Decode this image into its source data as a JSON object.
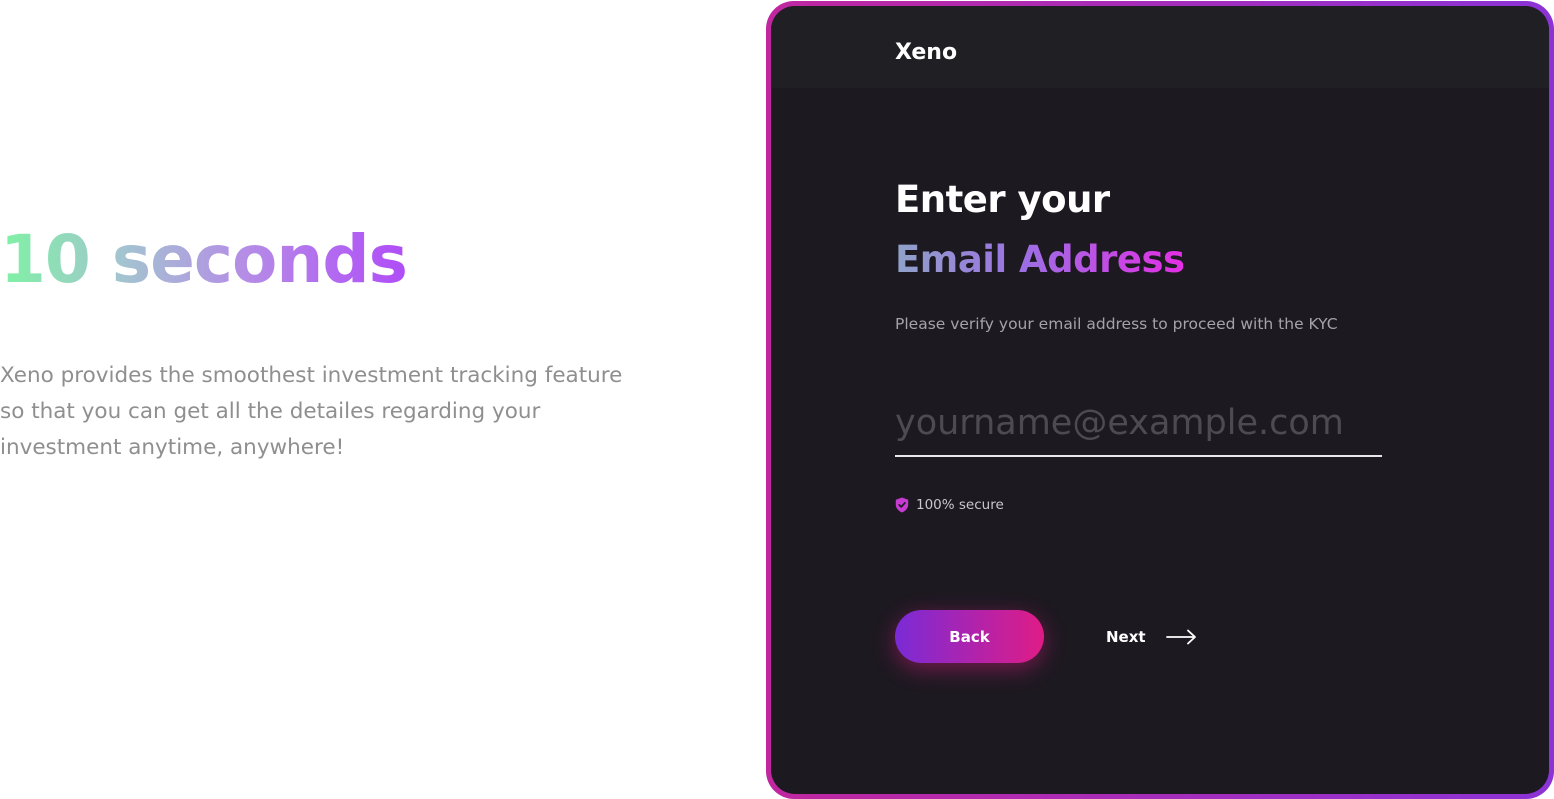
{
  "hero": {
    "heading": "10 seconds",
    "description": "Xeno provides the smoothest investment tracking feature so that you can get all the detailes regarding your investment anytime, anywhere!"
  },
  "app": {
    "brand": "Xeno",
    "title_line1": "Enter your",
    "title_line2": "Email Address",
    "subtitle": "Please verify your email address to proceed with the KYC",
    "email": {
      "placeholder": "yourname@example.com",
      "value": ""
    },
    "secure_label": "100% secure",
    "back_label": "Back",
    "next_label": "Next",
    "icons": {
      "secure": "shield-check-icon",
      "next": "arrow-right-icon"
    },
    "colors": {
      "frame_start": "#c0279f",
      "frame_end": "#8b33d6",
      "screen_bg": "#1d1921",
      "button_start": "#7a2bd6",
      "button_end": "#e01c86",
      "shield": "#c63bd0"
    }
  }
}
